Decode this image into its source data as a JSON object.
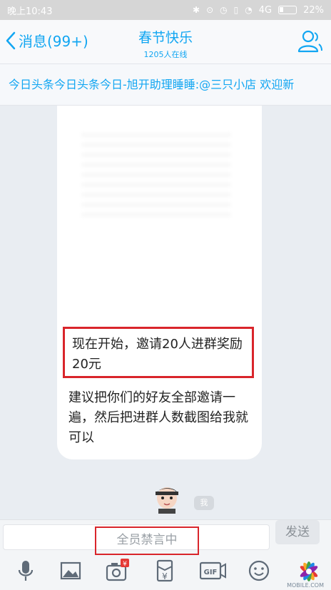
{
  "status_bar": {
    "time": "晚上10:43",
    "network": "4G",
    "battery": "22%"
  },
  "header": {
    "back_label": "消息(99+)",
    "title": "春节快乐",
    "subtitle": "1205人在线"
  },
  "notice": {
    "text": "今日头条今日头条今日-旭开助理睡睡:@三只小店 欢迎新"
  },
  "messages": [
    {
      "text": "现在开始，邀请20人进群奖励20元"
    },
    {
      "text": "建议把你们的好友全部邀请一遍，然后把进群人数截图给我就可以"
    }
  ],
  "me_tag": "我",
  "input": {
    "placeholder": "全员禁言中",
    "send_label": "发送"
  },
  "toolbar": {
    "icons": [
      "microphone-icon",
      "image-icon",
      "camera-icon",
      "red-packet-icon",
      "gif-icon",
      "emoji-icon"
    ],
    "camera_badge": "¥",
    "gif_label": "GIF",
    "red_packet_symbol": "¥"
  },
  "watermark": {
    "text": "MOBILE.COM"
  },
  "colors": {
    "accent": "#12a6f2",
    "highlight": "#d9252b",
    "background": "#e9edf2"
  }
}
